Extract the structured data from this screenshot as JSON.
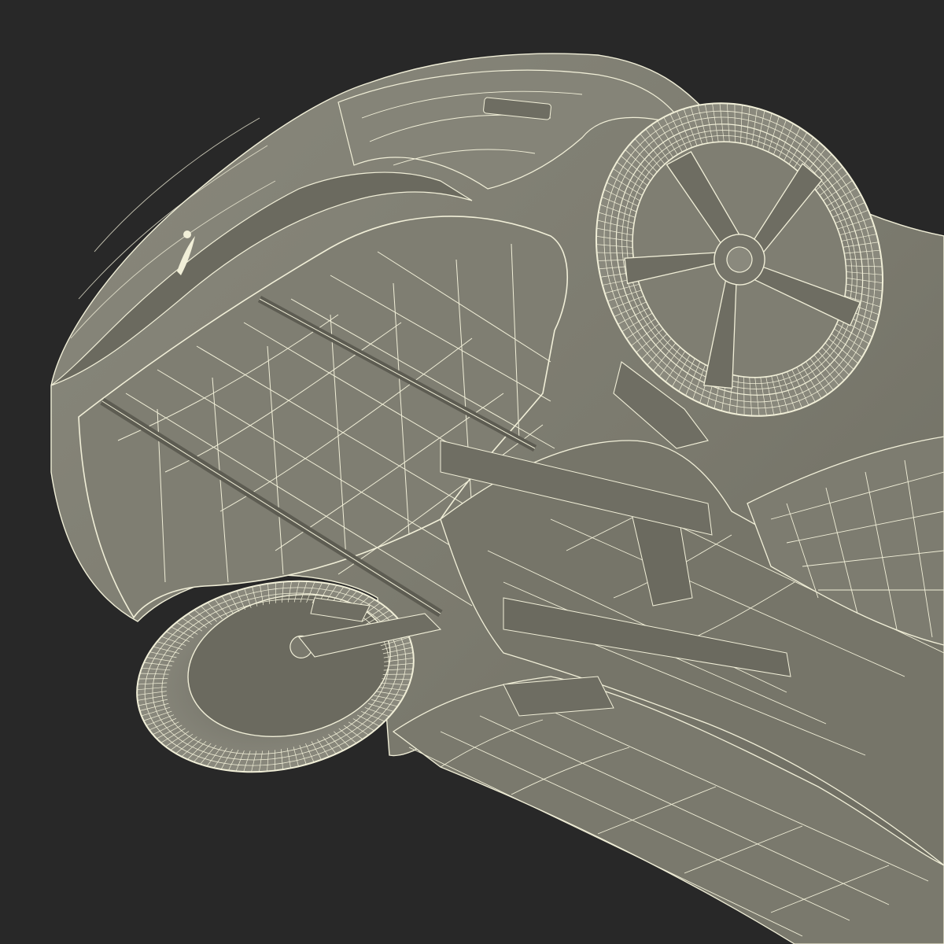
{
  "scene": {
    "background_color": "#282828",
    "surface_color": "#7e7d71",
    "surface_shadow_color": "#5d5c52",
    "surface_highlight_color": "#97968a",
    "wire_color": "#f1efd8",
    "subject": "car-underside-wireframe"
  }
}
